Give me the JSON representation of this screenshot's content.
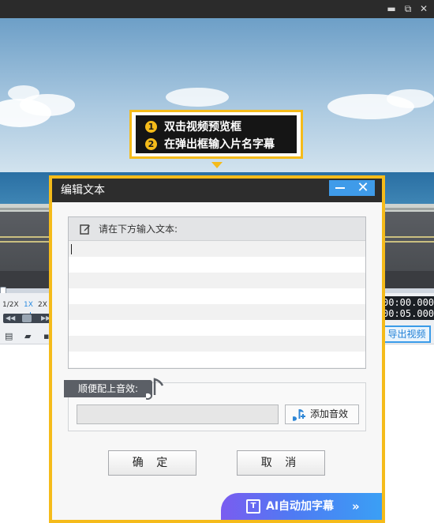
{
  "window": {
    "controls": {
      "minimize": "▬",
      "maximize": "⧉",
      "close": "✕"
    }
  },
  "player": {
    "speeds": [
      "1/2X",
      "1X",
      "2X"
    ],
    "current_time": "00:00.000",
    "total_time": "00:05.000",
    "export_label": "导出视频",
    "seek_progress": 0.0
  },
  "callout": {
    "steps": [
      {
        "num": "1",
        "text": "双击视频预览框"
      },
      {
        "num": "2",
        "text": "在弹出框输入片名字幕"
      }
    ]
  },
  "dialog": {
    "title": "编辑文本",
    "text_prompt": "请在下方输入文本:",
    "text_value": "",
    "sound_label": "顺便配上音效:",
    "sound_value": "",
    "add_sound_label": "添加音效",
    "ok_label": "确 定",
    "cancel_label": "取 消",
    "ai_label": "AI自动加字幕",
    "ai_chevron": "»"
  },
  "colors": {
    "accent_yellow": "#f5bb1a",
    "accent_blue": "#3f9be9",
    "ai_gradient_start": "#7a5cf0",
    "ai_gradient_end": "#3aa0f5"
  }
}
